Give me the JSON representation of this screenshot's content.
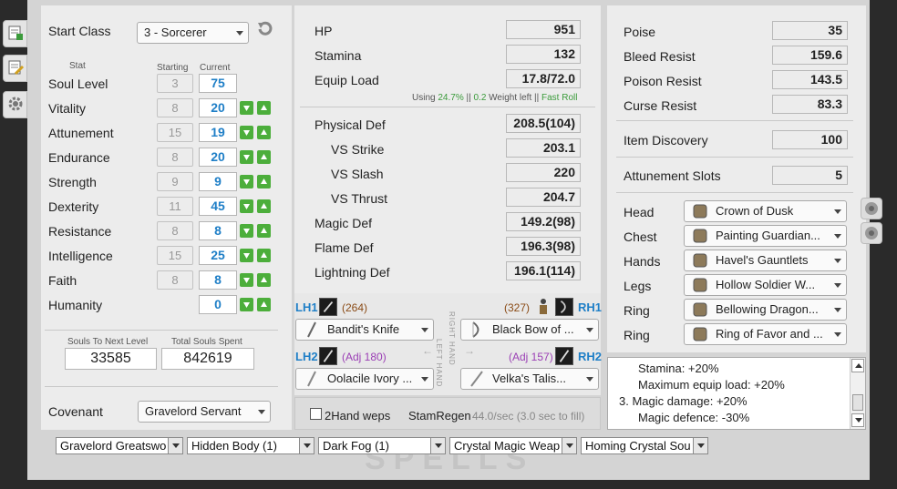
{
  "side_tabs": [
    {
      "icon": "character-sheet-icon"
    },
    {
      "icon": "notes-edit-icon"
    },
    {
      "icon": "gear-icon"
    }
  ],
  "left": {
    "start_class_label": "Start Class",
    "start_class_value": "3 - Sorcerer",
    "reset_icon": "undo-arrow-icon",
    "col_stat": "Stat",
    "col_starting": "Starting",
    "col_current": "Current",
    "stats": [
      {
        "name": "Soul Level",
        "start": "3",
        "current": "75",
        "arrows": false
      },
      {
        "name": "Vitality",
        "start": "8",
        "current": "20",
        "arrows": true
      },
      {
        "name": "Attunement",
        "start": "15",
        "current": "19",
        "arrows": true
      },
      {
        "name": "Endurance",
        "start": "8",
        "current": "20",
        "arrows": true
      },
      {
        "name": "Strength",
        "start": "9",
        "current": "9",
        "arrows": true
      },
      {
        "name": "Dexterity",
        "start": "11",
        "current": "45",
        "arrows": true
      },
      {
        "name": "Resistance",
        "start": "8",
        "current": "8",
        "arrows": true
      },
      {
        "name": "Intelligence",
        "start": "15",
        "current": "25",
        "arrows": true
      },
      {
        "name": "Faith",
        "start": "8",
        "current": "8",
        "arrows": true
      },
      {
        "name": "Humanity",
        "start": "",
        "current": "0",
        "arrows": true
      }
    ],
    "souls_next_label": "Souls To Next Level",
    "souls_next_value": "33585",
    "souls_total_label": "Total Souls Spent",
    "souls_total_value": "842619",
    "covenant_label": "Covenant",
    "covenant_value": "Gravelord Servant"
  },
  "mid": {
    "hp_label": "HP",
    "hp": "951",
    "stamina_label": "Stamina",
    "stamina": "132",
    "equip_label": "Equip Load",
    "equip": "17.8/72.0",
    "using_prefix": "Using",
    "using_pct": "24.7%",
    "using_sep": "||",
    "using_left": "0.2",
    "using_weight": "Weight left",
    "using_roll": "Fast Roll",
    "defs": [
      {
        "label": "Physical Def",
        "value": "208.5(104)",
        "indent": false
      },
      {
        "label": "VS Strike",
        "value": "203.1",
        "indent": true
      },
      {
        "label": "VS Slash",
        "value": "220",
        "indent": true
      },
      {
        "label": "VS Thrust",
        "value": "204.7",
        "indent": true
      },
      {
        "label": "Magic Def",
        "value": "149.2(98)",
        "indent": false
      },
      {
        "label": "Flame Def",
        "value": "196.3(98)",
        "indent": false
      },
      {
        "label": "Lightning Def",
        "value": "196.1(114)",
        "indent": false
      }
    ]
  },
  "weapons": {
    "lh1_label": "LH1",
    "lh1_num": "(264)",
    "rh1_label": "RH1",
    "rh1_num": "(327)",
    "lh2_label": "LH2",
    "lh2_adj": "(Adj 180)",
    "rh2_label": "RH2",
    "rh2_adj": "(Adj 157)",
    "lh1_weapon": "Bandit's Knife",
    "rh1_weapon": "Black Bow of ...",
    "lh2_weapon": "Oolacile Ivory ...",
    "rh2_weapon": "Velka's Talis...",
    "right_hand_text": "RIGHT HAND",
    "left_hand_text": "LEFT HAND",
    "two_hand_label": "2Hand weps",
    "stam_regen_label": "StamRegen",
    "stam_regen_value": "44.0/sec (3.0 sec to fill)"
  },
  "right": {
    "stats": [
      {
        "label": "Poise",
        "value": "35"
      },
      {
        "label": "Bleed Resist",
        "value": "159.6"
      },
      {
        "label": "Poison Resist",
        "value": "143.5"
      },
      {
        "label": "Curse Resist",
        "value": "83.3"
      }
    ],
    "item_discovery_label": "Item Discovery",
    "item_discovery": "100",
    "attune_label": "Attunement Slots",
    "attune": "5",
    "equip": [
      {
        "slot": "Head",
        "item": "Crown of Dusk"
      },
      {
        "slot": "Chest",
        "item": "Painting Guardian..."
      },
      {
        "slot": "Hands",
        "item": "Havel's Gauntlets"
      },
      {
        "slot": "Legs",
        "item": "Hollow Soldier W..."
      },
      {
        "slot": "Ring",
        "item": "Bellowing Dragon..."
      },
      {
        "slot": "Ring",
        "item": "Ring of Favor and ..."
      }
    ]
  },
  "notes": {
    "lines": [
      "Stamina: +20%",
      "Maximum equip load: +20%",
      "3.  Magic damage: +20%",
      "Magic defence: -30%"
    ]
  },
  "spells": {
    "watermark": "SPELLS",
    "slots": [
      "Gravelord Greatswo",
      "Hidden Body (1)",
      "Dark Fog (1)",
      "Crystal Magic Weap",
      "Homing Crystal Sou"
    ]
  },
  "colors": {
    "accent": "#1f7fc7",
    "green": "#4cae3b",
    "purple": "#9b3fb5",
    "brown": "#8a4b16"
  }
}
